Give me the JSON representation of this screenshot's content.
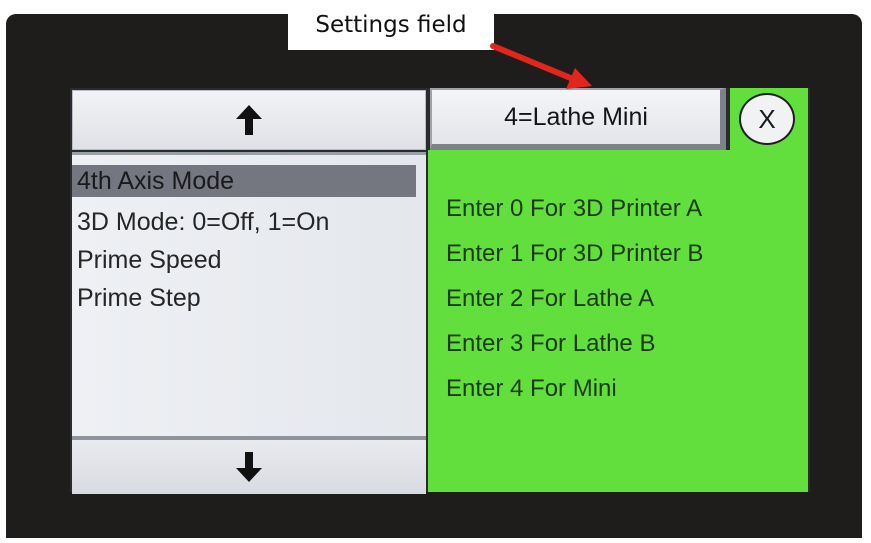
{
  "annotation": {
    "label": "Settings field",
    "arrow_color": "#e2261d"
  },
  "left_panel": {
    "up_button_icon": "arrow-up-icon",
    "up_glyph": "🡅",
    "items": [
      {
        "label": "4th Axis Mode",
        "selected": true
      },
      {
        "label": "3D Mode: 0=Off, 1=On",
        "selected": false
      },
      {
        "label": "Prime Speed",
        "selected": false
      },
      {
        "label": "Prime Step",
        "selected": false
      }
    ],
    "down_button_icon": "arrow-down-icon",
    "down_glyph": "🡇"
  },
  "settings": {
    "value": "4=Lathe Mini",
    "close_label": "X"
  },
  "help_panel": {
    "background": "#62df3d",
    "lines": [
      "Enter 0 For 3D Printer A",
      "Enter 1 For 3D Printer B",
      "Enter 2 For Lathe A",
      "Enter 3 For Lathe B",
      "Enter 4 For Mini"
    ]
  }
}
